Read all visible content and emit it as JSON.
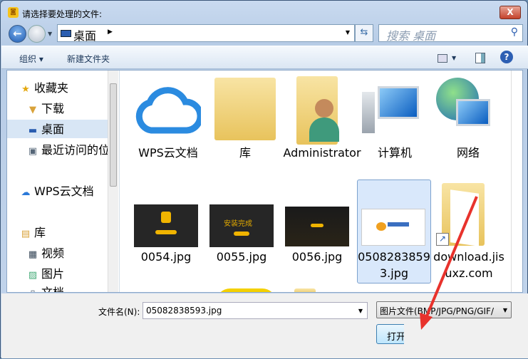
{
  "title": "请选择要处理的文件:",
  "address": {
    "location": "桌面"
  },
  "search": {
    "placeholder": "搜索 桌面"
  },
  "toolbar": {
    "organize": "组织 ▾",
    "new_folder": "新建文件夹"
  },
  "sidebar": {
    "items": [
      {
        "label": "收藏夹",
        "icon": "star-icon"
      },
      {
        "label": "下载",
        "icon": "download-folder-icon"
      },
      {
        "label": "桌面",
        "icon": "desktop-icon",
        "selected": true
      },
      {
        "label": "最近访问的位置",
        "icon": "recent-places-icon"
      },
      {
        "label": "WPS云文档",
        "icon": "cloud-icon"
      },
      {
        "label": "库",
        "icon": "library-icon"
      },
      {
        "label": "视频",
        "icon": "video-icon"
      },
      {
        "label": "图片",
        "icon": "pictures-icon"
      },
      {
        "label": "文档",
        "icon": "documents-icon"
      }
    ]
  },
  "files": [
    {
      "name": "WPS云文档",
      "type": "cloud"
    },
    {
      "name": "库",
      "type": "library"
    },
    {
      "name": "Administrator",
      "type": "user-folder"
    },
    {
      "name": "计算机",
      "type": "computer"
    },
    {
      "name": "网络",
      "type": "network"
    },
    {
      "name": "0054.jpg",
      "type": "image"
    },
    {
      "name": "0055.jpg",
      "type": "image",
      "thumb_text": "安装完成"
    },
    {
      "name": "0056.jpg",
      "type": "image"
    },
    {
      "name": "05082838593.jpg",
      "type": "image",
      "selected": true
    },
    {
      "name": "download.jisuxz.com",
      "type": "shortcut-folder"
    }
  ],
  "footer": {
    "filename_label": "文件名(N):",
    "filename_value": "05082838593.jpg",
    "filter_value": "图片文件(BMP/JPG/PNG/GIF/",
    "open_button": "打开"
  },
  "colors": {
    "selection": "#d9e8fb",
    "annotation_arrow": "#e8322c"
  }
}
